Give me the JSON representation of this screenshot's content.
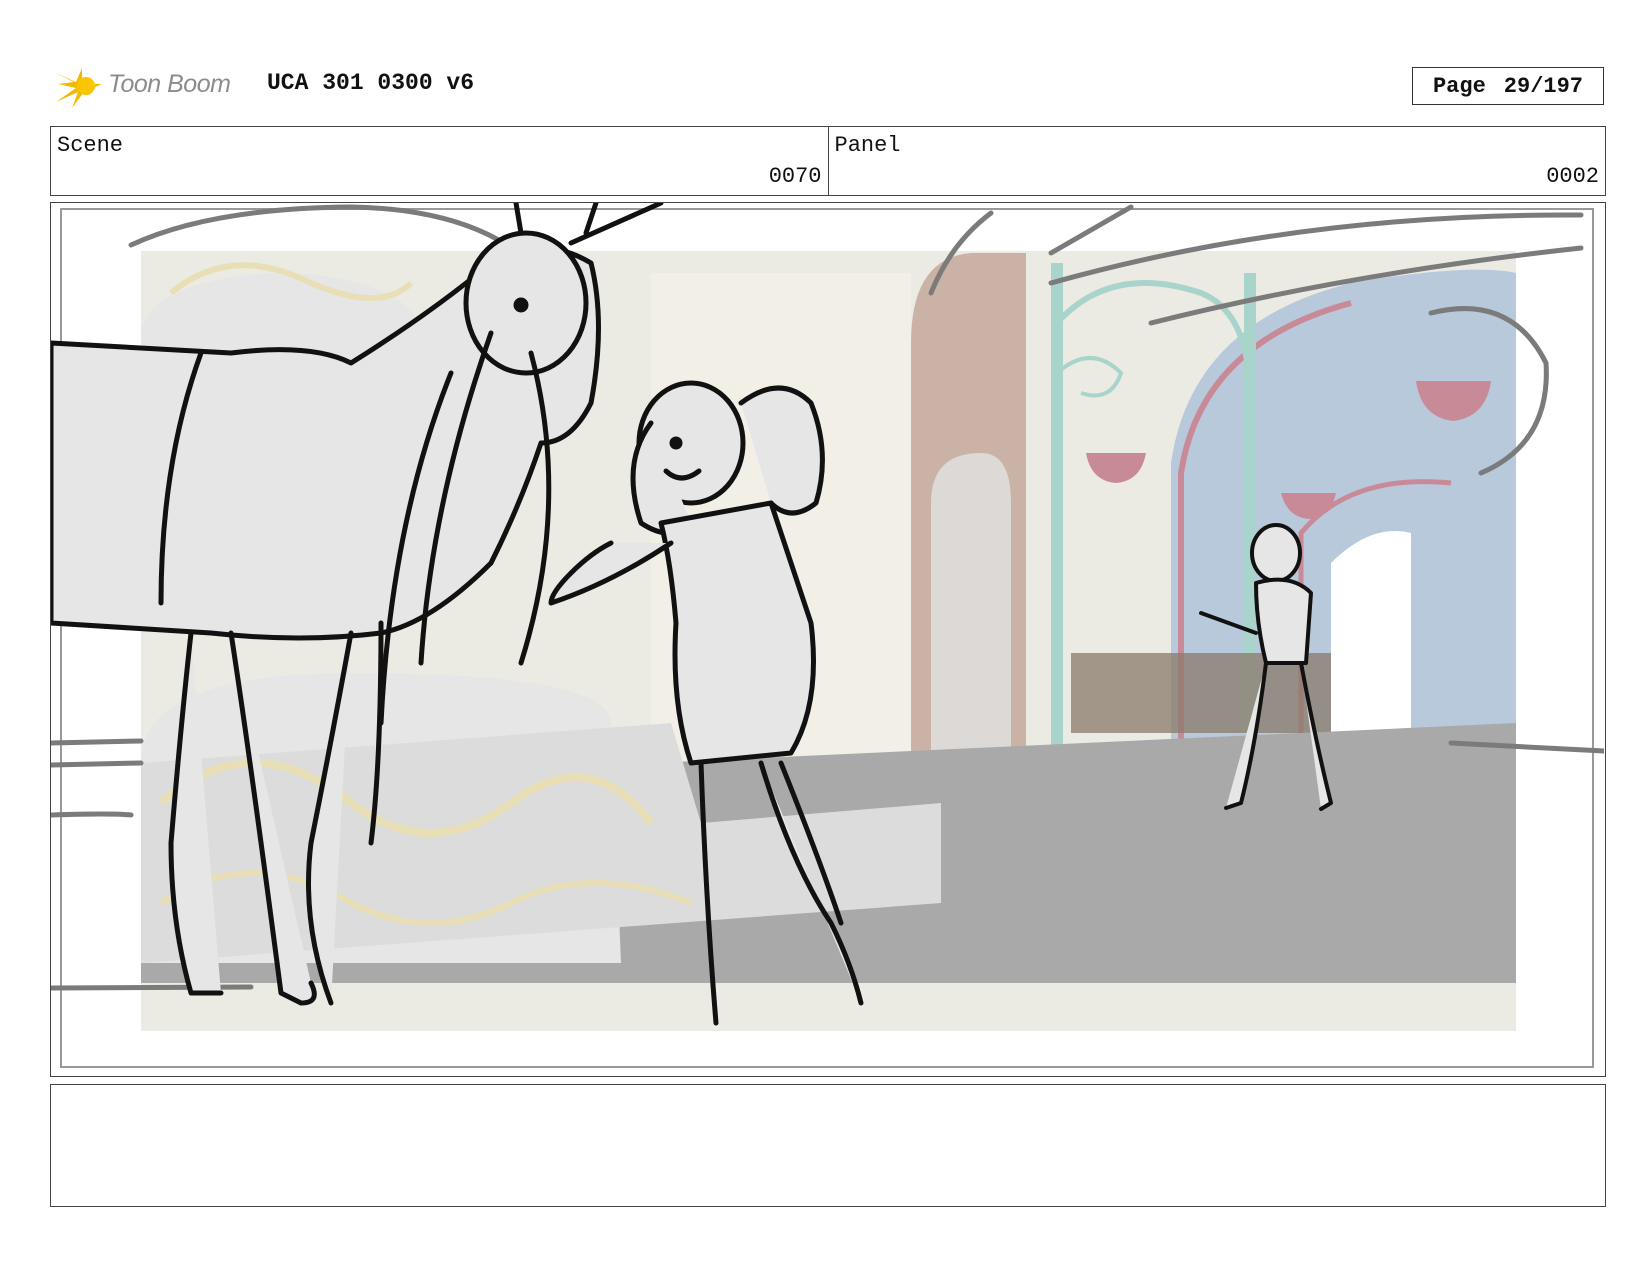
{
  "header": {
    "logo_text": "Toon Boom",
    "project_title": "UCA 301 0300 v6",
    "page_label": "Page",
    "page_number": "29/197"
  },
  "info": {
    "scene_label": "Scene",
    "scene_value": "0070",
    "panel_label": "Panel",
    "panel_value": "0002"
  },
  "panel_image": {
    "icon": "storyboard-sketch",
    "colors": {
      "floor": "#a9a9a9",
      "wall": "#ecebe3",
      "arch": "#cbb2a6",
      "window": "#b8c9dc",
      "pillar": "#a9d4cc",
      "basket": "#c98a98",
      "fountain": "#e6e6e6",
      "ornament": "#e9dfb6"
    }
  },
  "notes": {
    "text": ""
  }
}
